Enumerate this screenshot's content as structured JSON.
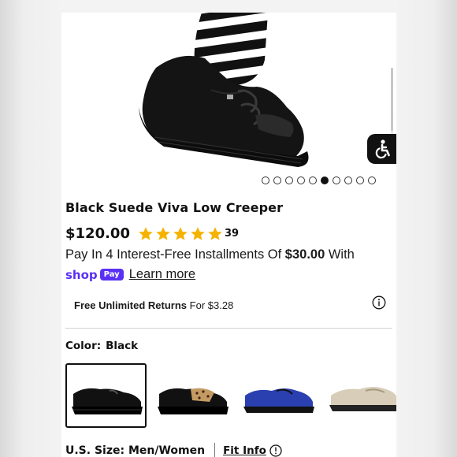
{
  "product": {
    "title": "Black Suede Viva Low Creeper",
    "price": "$120.00",
    "rating_stars": 5,
    "review_count": "39"
  },
  "gallery": {
    "image_count": 10,
    "active_index": 5
  },
  "installments": {
    "prefix": "Pay In 4 Interest-Free Installments Of",
    "amount": "$30.00",
    "suffix": "With",
    "shop_word": "shop",
    "pay_word": "Pay",
    "learn_more": "Learn more"
  },
  "returns": {
    "bold_text": "Free Unlimited Returns",
    "suffix": "For $3.28"
  },
  "color": {
    "label": "Color:",
    "value": "Black",
    "swatches": [
      {
        "name": "black-suede",
        "selected": true
      },
      {
        "name": "black-leopard",
        "selected": false
      },
      {
        "name": "blue-suede",
        "selected": false
      },
      {
        "name": "beige-loafer",
        "selected": false
      }
    ]
  },
  "size": {
    "label": "U.S. Size: Men/Women",
    "fit_info": "Fit Info"
  },
  "icons": {
    "accessibility": "accessibility-icon",
    "info": "info-icon",
    "help": "help-icon",
    "star": "star-icon"
  },
  "colors": {
    "star": "#f5b301",
    "shop_pay": "#5a31f4",
    "accessibility_bg": "#111111"
  }
}
